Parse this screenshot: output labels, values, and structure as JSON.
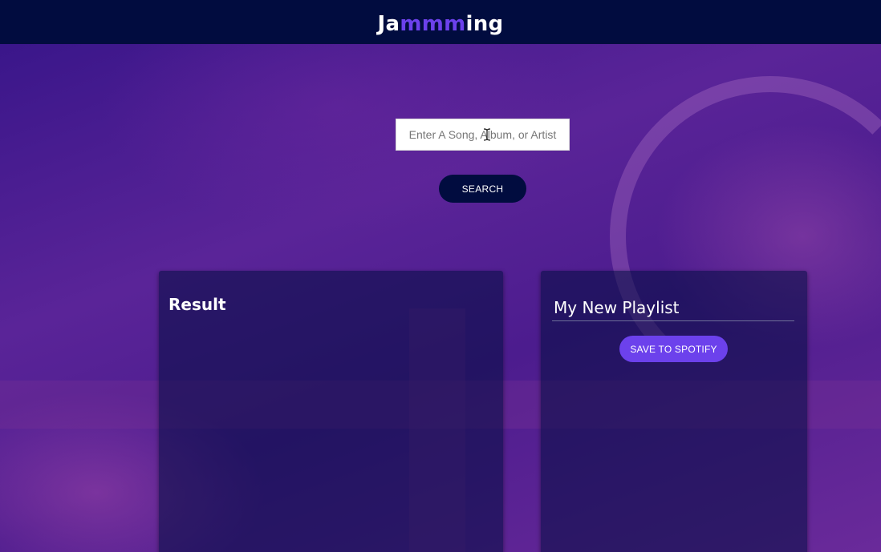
{
  "header": {
    "logo_prefix": "Ja",
    "logo_accent": "mmm",
    "logo_suffix": "ing"
  },
  "search": {
    "placeholder": "Enter A Song, Album, or Artist",
    "button_label": "SEARCH"
  },
  "results": {
    "title": "Result"
  },
  "playlist": {
    "name": "My New Playlist",
    "save_label": "SAVE TO SPOTIFY"
  },
  "colors": {
    "header_bg": "#010c3f",
    "accent": "#6c41ec",
    "background_purple": "#4b1e8c"
  },
  "icons": {
    "cursor": "text-cursor-icon"
  }
}
